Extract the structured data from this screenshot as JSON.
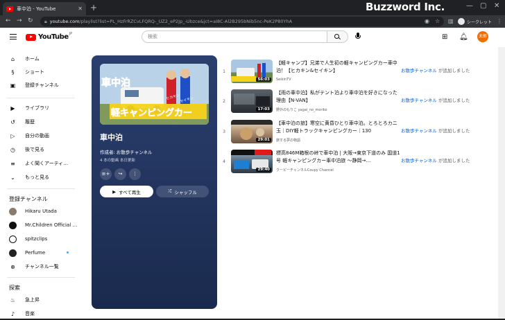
{
  "browser": {
    "tab_title": "車中泊 - YouTube",
    "tab_close": "✕",
    "new_tab": "+",
    "brand_watermark": "Buzzword Inc.",
    "url_host": "youtube.com",
    "url_path": "/playlist?list=PL_HzFrRZCvLFQRQ-_UZ2_eP2Jp_-Ubzce&jct=aI8C-Al2B295bNib5nc-PeK2P80YhA",
    "incognito_label": "シークレット"
  },
  "header": {
    "logo_text": "YouTube",
    "logo_region": "JP",
    "search_placeholder": "検索",
    "avatar_initial": "太郎"
  },
  "sidebar": {
    "main": [
      {
        "icon": "home-icon",
        "glyph": "⌂",
        "label": "ホーム"
      },
      {
        "icon": "shorts-icon",
        "glyph": "§",
        "label": "ショート"
      },
      {
        "icon": "subscriptions-icon",
        "glyph": "▣",
        "label": "登録チャンネル"
      }
    ],
    "library": [
      {
        "icon": "library-icon",
        "glyph": "▶",
        "label": "ライブラリ"
      },
      {
        "icon": "history-icon",
        "glyph": "↺",
        "label": "履歴"
      },
      {
        "icon": "your-videos-icon",
        "glyph": "▷",
        "label": "自分の動画"
      },
      {
        "icon": "watch-later-icon",
        "glyph": "◷",
        "label": "後で見る"
      },
      {
        "icon": "playlist-icon",
        "glyph": "≡",
        "label": "よく聞くアーティ…"
      },
      {
        "icon": "chevron-down-icon",
        "glyph": "⌄",
        "label": "もっと見る"
      }
    ],
    "subscriptions_heading": "登録チャンネル",
    "channels": [
      {
        "label": "Hikaru Utada",
        "color": "#8a7a6a"
      },
      {
        "label": "Mr.Children Official …",
        "color": "#111111"
      },
      {
        "label": "spitzclips",
        "color": "#ffffff"
      },
      {
        "label": "Perfume",
        "color": "#222222"
      },
      {
        "label": "チャンネル一覧",
        "color": "#ffffff"
      }
    ],
    "explore_heading": "探索",
    "explore": [
      {
        "icon": "trending-icon",
        "glyph": "♨",
        "label": "急上昇"
      },
      {
        "icon": "music-icon",
        "glyph": "♪",
        "label": "音楽"
      }
    ]
  },
  "playlist": {
    "thumb_text_1": "車中泊",
    "thumb_text_2": "軽キャンピングカー",
    "thumb_text_3": "ヒカキン",
    "thumb_text_4": "セイキン",
    "title": "車中泊",
    "owner": "作成者: お散歩チャンネル",
    "meta": "4 本の動画  本日更新",
    "play_all": "すべて再生",
    "shuffle": "シャッフル"
  },
  "videos": [
    {
      "num": "1",
      "title": "【軽キャンプ】兄弟で人生初の軽キャンピングカー車中泊！【ヒカキン&セイキン】",
      "channel": "SeikinTV",
      "duration": "56:03",
      "added_by": "お散歩チャンネル",
      "added_suffix": " が追加しました",
      "thumb": "#9bb7d4"
    },
    {
      "num": "2",
      "title": "【雨の車中泊】私がテント泊より車中泊を好きになった理由【N-VAN】",
      "channel": "野外のもりこ yagai_no_moriko",
      "duration": "17:03",
      "added_by": "お散歩チャンネル",
      "added_suffix": " が追加しました",
      "thumb": "#4a4f55"
    },
    {
      "num": "3",
      "title": "【車中泊の旅】寒空に黄昏ひとり車中泊。とろとろカニ玉｜DIY軽トラックキャンピングカー｜130",
      "channel": "旅する夢の物語",
      "duration": "29:01",
      "added_by": "お散歩チャンネル",
      "added_suffix": " が追加しました",
      "thumb": "#6b5a4a"
    },
    {
      "num": "4",
      "title": "標高846M箱根の峠で車中泊 | 大阪→東京下道のみ 国道1号 軽キャンピングカー車中泊旅 ～静岡→…",
      "channel": "クーピーチャンネルCoupy Channel",
      "duration": "29:40",
      "added_by": "お散歩チャンネル",
      "added_suffix": " が追加しました",
      "thumb": "#3d4f62"
    }
  ]
}
